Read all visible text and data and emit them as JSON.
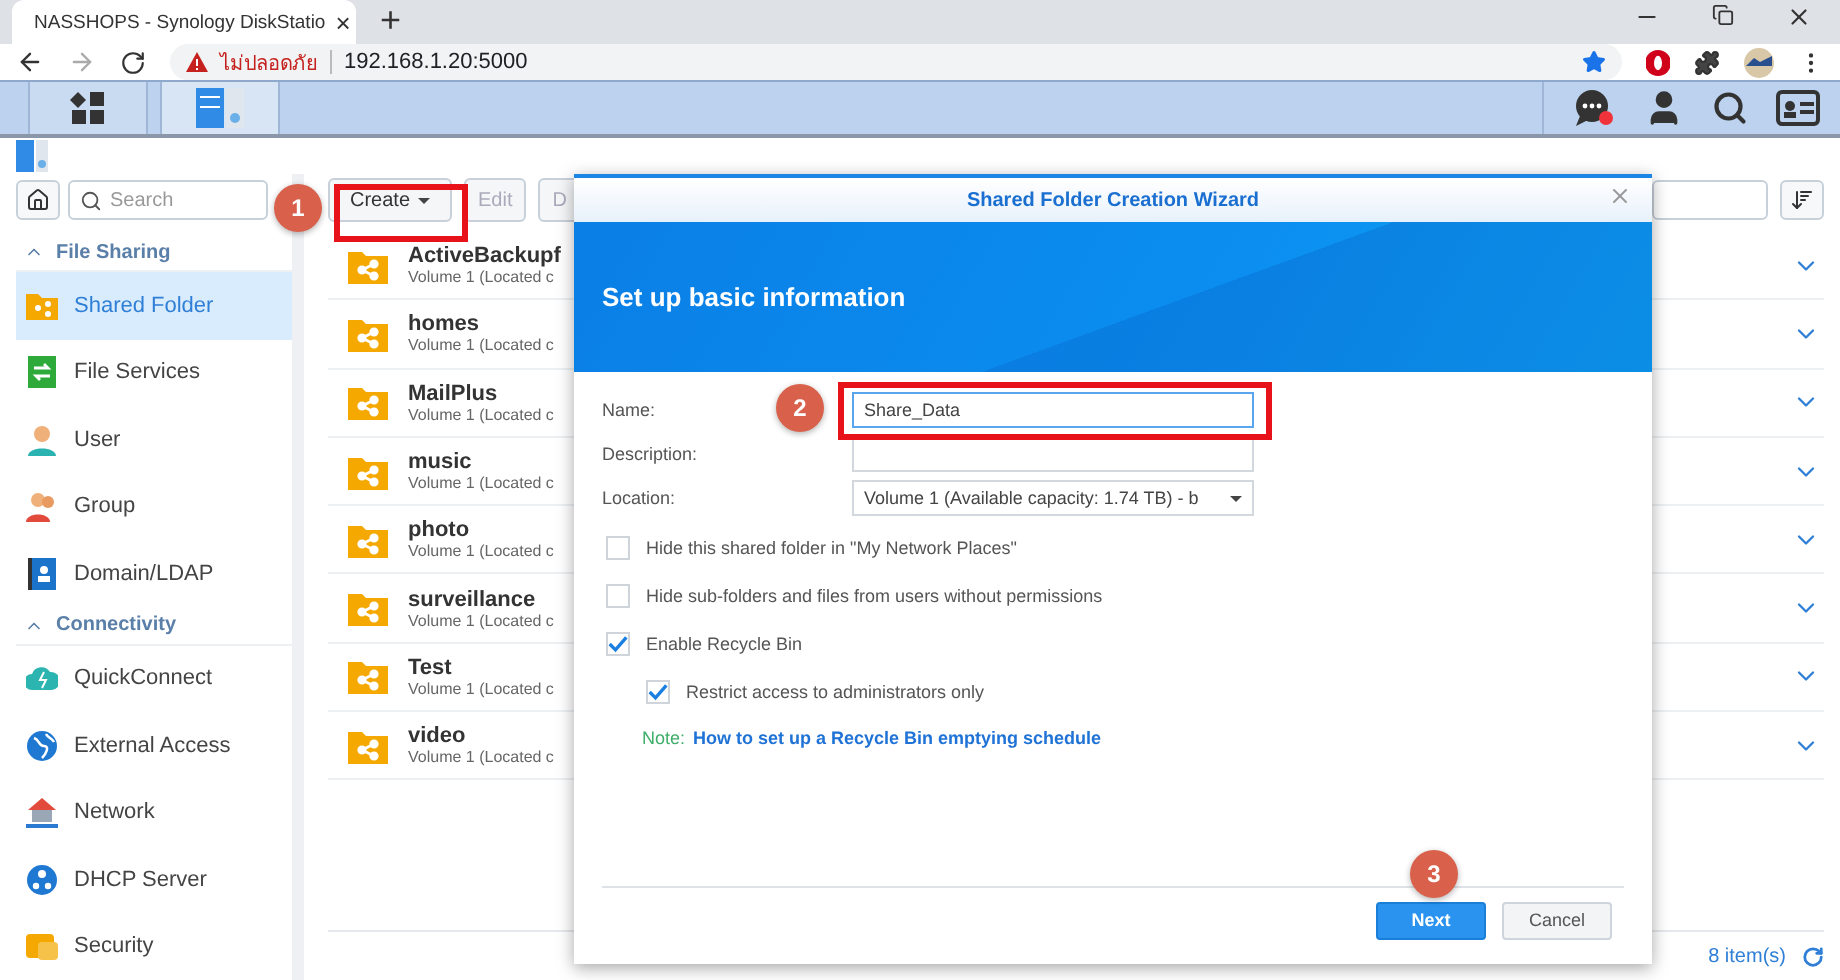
{
  "browser": {
    "tab": {
      "title": "NASSHOPS - Synology DiskStatio",
      "close": "×"
    },
    "new_tab": "+",
    "security_label": "ไม่ปลอดภัย",
    "url": "192.168.1.20:5000"
  },
  "control_panel": {
    "sidebar": {
      "search": {
        "placeholder": "Search"
      },
      "sections": [
        {
          "title": "File Sharing",
          "expanded": true,
          "items": [
            {
              "label": "Shared Folder",
              "selected": true
            },
            {
              "label": "File Services",
              "selected": false
            },
            {
              "label": "User",
              "selected": false
            },
            {
              "label": "Group",
              "selected": false
            },
            {
              "label": "Domain/LDAP",
              "selected": false
            }
          ]
        },
        {
          "title": "Connectivity",
          "expanded": true,
          "items": [
            {
              "label": "QuickConnect",
              "selected": false
            },
            {
              "label": "External Access",
              "selected": false
            },
            {
              "label": "Network",
              "selected": false
            },
            {
              "label": "DHCP Server",
              "selected": false
            },
            {
              "label": "Security",
              "selected": false
            }
          ]
        }
      ]
    },
    "toolbar": [
      {
        "label": "Create",
        "kind": "menu",
        "disabled": false
      },
      {
        "label": "Edit",
        "kind": "plain",
        "disabled": true
      },
      {
        "label": "D",
        "kind": "plain",
        "disabled": true
      }
    ],
    "rows": [
      {
        "name": "ActiveBackupf",
        "location": "Volume 1 (Located c"
      },
      {
        "name": "homes",
        "location": "Volume 1 (Located c"
      },
      {
        "name": "MailPlus",
        "location": "Volume 1 (Located c"
      },
      {
        "name": "music",
        "location": "Volume 1 (Located c"
      },
      {
        "name": "photo",
        "location": "Volume 1 (Located c"
      },
      {
        "name": "surveillance",
        "location": "Volume 1 (Located c"
      },
      {
        "name": "Test",
        "location": "Volume 1 (Located c"
      },
      {
        "name": "video",
        "location": "Volume 1 (Located c"
      }
    ],
    "status_bar": {
      "count": "8 item(s)"
    }
  },
  "dialog": {
    "title": "Shared Folder Creation Wizard",
    "heading": "Set up basic information",
    "fields": [
      {
        "label": "Name:",
        "kind": "text",
        "value": "Share_Data",
        "focused": true
      },
      {
        "label": "Description:",
        "kind": "text",
        "focused": false
      },
      {
        "label": "Location:",
        "kind": "select",
        "value": "Volume 1 (Available capacity:  1.74 TB) - b",
        "focused": false
      }
    ],
    "options": [
      {
        "label": "Hide this shared folder in \"My Network Places\"",
        "checked": false
      },
      {
        "label": "Hide sub-folders and files from users without permissions",
        "checked": false
      },
      {
        "label": "Enable Recycle Bin",
        "checked": true,
        "children": [
          {
            "label": "Restrict access to administrators only",
            "checked": true
          }
        ]
      }
    ],
    "note": {
      "label": "Note:",
      "link": "How to set up a Recycle Bin emptying schedule"
    },
    "buttons": [
      {
        "label": "Next",
        "kind": "primary"
      },
      {
        "label": "Cancel",
        "kind": "secondary"
      }
    ]
  },
  "annotations": [
    {
      "number": "1",
      "highlight": true
    },
    {
      "number": "2",
      "highlight": true
    },
    {
      "number": "3",
      "highlight": false
    }
  ]
}
